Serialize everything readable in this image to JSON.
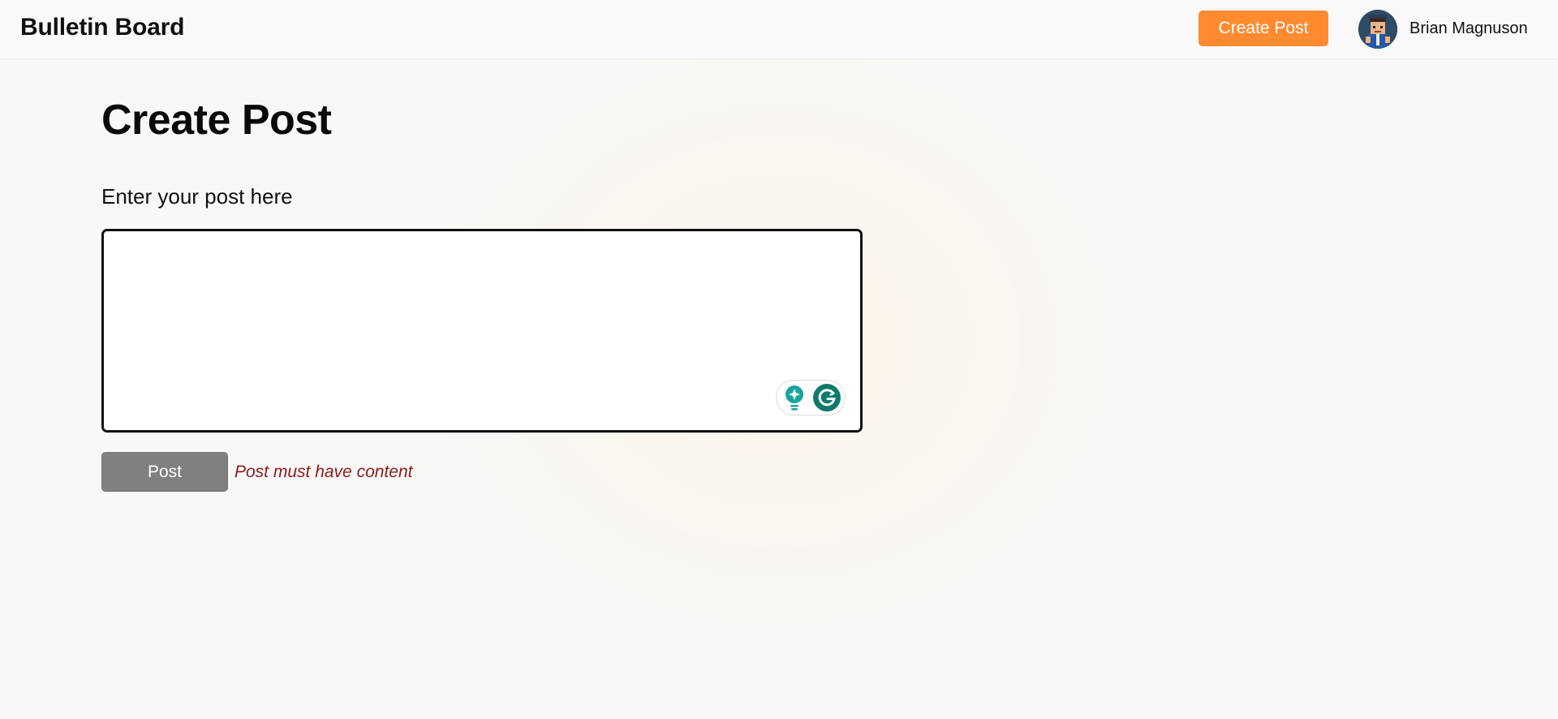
{
  "header": {
    "brand": "Bulletin Board",
    "create_post_label": "Create Post",
    "user_name": "Brian Magnuson",
    "accent_color": "#ff8a30"
  },
  "main": {
    "title": "Create Post",
    "field_label": "Enter your post here",
    "textarea_value": "",
    "post_button_label": "Post",
    "error_message": "Post must have content",
    "error_color": "#8b1a1a"
  },
  "grammar_widget": {
    "icons": [
      "lightbulb-icon",
      "grammarly-g-icon"
    ]
  }
}
